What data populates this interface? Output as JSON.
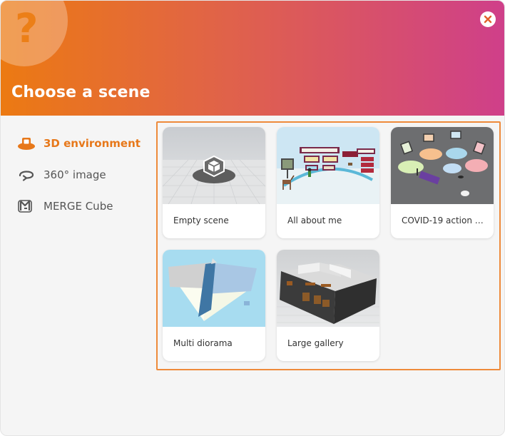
{
  "dialog": {
    "title": "Choose a scene",
    "header_icon": "question-mark-icon",
    "header_glyph": "?",
    "close_icon": "close-icon"
  },
  "colors": {
    "accent": "#e7781a",
    "header_gradient_start": "#ec7a12",
    "header_gradient_end": "#cf3f8a",
    "selection_border": "#ee8a3a"
  },
  "sidebar": {
    "items": [
      {
        "label": "3D environment",
        "icon": "cube-stand-icon",
        "active": true
      },
      {
        "label": "360° image",
        "icon": "rotate-360-icon",
        "active": false
      },
      {
        "label": "MERGE Cube",
        "icon": "merge-cube-icon",
        "active": false
      }
    ]
  },
  "scenes": [
    {
      "name": "Empty scene",
      "thumbnail": "empty-scene-thumbnail"
    },
    {
      "name": "All about me",
      "thumbnail": "all-about-me-thumbnail"
    },
    {
      "name": "COVID-19 action pl...",
      "thumbnail": "covid-action-plan-thumbnail"
    },
    {
      "name": "Multi diorama",
      "thumbnail": "multi-diorama-thumbnail"
    },
    {
      "name": "Large gallery",
      "thumbnail": "large-gallery-thumbnail"
    }
  ]
}
